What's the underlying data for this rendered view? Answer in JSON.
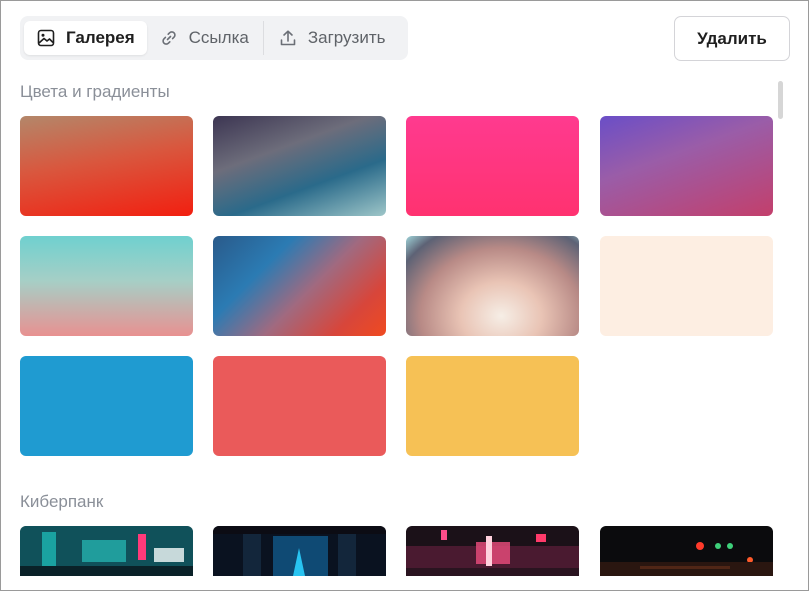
{
  "tabs": [
    {
      "label": "Галерея",
      "icon": "image-icon",
      "active": true
    },
    {
      "label": "Ссылка",
      "icon": "link-icon",
      "active": false
    },
    {
      "label": "Загрузить",
      "icon": "upload-icon",
      "active": false
    }
  ],
  "delete_label": "Удалить",
  "sections": {
    "colors": {
      "title": "Цвета и градиенты",
      "tiles": [
        {
          "name": "gradient-orange-red",
          "bg": "linear-gradient(170deg,#b3876a 0%,#d9573e 45%,#f21f10 100%)"
        },
        {
          "name": "gradient-dusk-teal",
          "bg": "linear-gradient(160deg,#3c3552 0%,#6d6d7b 35%,#2a6a8a 65%,#9ec6c8 100%)"
        },
        {
          "name": "gradient-hot-pink",
          "bg": "linear-gradient(180deg,#ff3a8f 0%,#ff3270 100%)"
        },
        {
          "name": "gradient-violet-magenta",
          "bg": "linear-gradient(160deg,#6a4ec7 0%,#9a5da8 40%,#c33f6b 100%)"
        },
        {
          "name": "gradient-mint-coral",
          "bg": "linear-gradient(180deg,#6fd0cf 0%,#a6cfc6 45%,#e89191 100%)"
        },
        {
          "name": "gradient-blue-orange",
          "bg": "linear-gradient(135deg,#2a5a8a 0%,#2b7bb3 30%,#a06a80 55%,#d7463b 80%,#f04a20 100%)"
        },
        {
          "name": "gradient-smoke-cyan",
          "bg": "radial-gradient(ellipse at 55% 80%,#f6eee6 0%,#e9c4b5 30%,#b88a86 60%,#5d6275 85%,#9fd3d8 100%)"
        },
        {
          "name": "solid-cream",
          "bg": "#fdeee2"
        },
        {
          "name": "solid-blue",
          "bg": "#1f9bd1"
        },
        {
          "name": "solid-coral-red",
          "bg": "#ea5a5a"
        },
        {
          "name": "solid-mustard",
          "bg": "#f6c155"
        }
      ]
    },
    "cyberpunk": {
      "title": "Киберпанк",
      "tiles": [
        {
          "name": "cyberpunk-neon-street",
          "bg": "linear-gradient(180deg,#0e2b33 0%,#106d73 40%,#1d9b9d 70%,#0b2c36 100%)"
        },
        {
          "name": "cyberpunk-blue-tunnel",
          "bg": "linear-gradient(180deg,#0a0f1a 0%,#0e3a58 50%,#1b84b0 100%)"
        },
        {
          "name": "cyberpunk-red-alley",
          "bg": "linear-gradient(180deg,#1a1016 0%,#5a1f38 45%,#d0466d 75%,#2a1220 100%)"
        },
        {
          "name": "cyberpunk-night-traffic",
          "bg": "linear-gradient(180deg,#0b0b0d 0%,#1a1512 50%,#3a1b12 80%,#121010 100%)"
        }
      ]
    }
  }
}
